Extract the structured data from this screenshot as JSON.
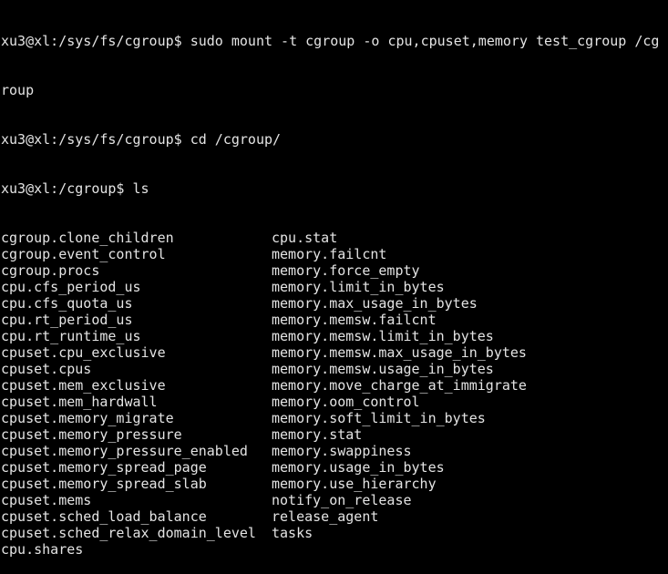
{
  "terminal": {
    "lines": [
      "xu3@xl:/sys/fs/cgroup$ sudo mount -t cgroup -o cpu,cpuset,memory test_cgroup /cg",
      "roup",
      "xu3@xl:/sys/fs/cgroup$ cd /cgroup/",
      "xu3@xl:/cgroup$ ls"
    ],
    "ls_rows": [
      [
        "cgroup.clone_children",
        "cpu.stat"
      ],
      [
        "cgroup.event_control",
        "memory.failcnt"
      ],
      [
        "cgroup.procs",
        "memory.force_empty"
      ],
      [
        "cpu.cfs_period_us",
        "memory.limit_in_bytes"
      ],
      [
        "cpu.cfs_quota_us",
        "memory.max_usage_in_bytes"
      ],
      [
        "cpu.rt_period_us",
        "memory.memsw.failcnt"
      ],
      [
        "cpu.rt_runtime_us",
        "memory.memsw.limit_in_bytes"
      ],
      [
        "cpuset.cpu_exclusive",
        "memory.memsw.max_usage_in_bytes"
      ],
      [
        "cpuset.cpus",
        "memory.memsw.usage_in_bytes"
      ],
      [
        "cpuset.mem_exclusive",
        "memory.move_charge_at_immigrate"
      ],
      [
        "cpuset.mem_hardwall",
        "memory.oom_control"
      ],
      [
        "cpuset.memory_migrate",
        "memory.soft_limit_in_bytes"
      ],
      [
        "cpuset.memory_pressure",
        "memory.stat"
      ],
      [
        "cpuset.memory_pressure_enabled",
        "memory.swappiness"
      ],
      [
        "cpuset.memory_spread_page",
        "memory.usage_in_bytes"
      ],
      [
        "cpuset.memory_spread_slab",
        "memory.use_hierarchy"
      ],
      [
        "cpuset.mems",
        "notify_on_release"
      ],
      [
        "cpuset.sched_load_balance",
        "release_agent"
      ],
      [
        "cpuset.sched_relax_domain_level",
        "tasks"
      ],
      [
        "cpu.shares",
        ""
      ]
    ]
  }
}
